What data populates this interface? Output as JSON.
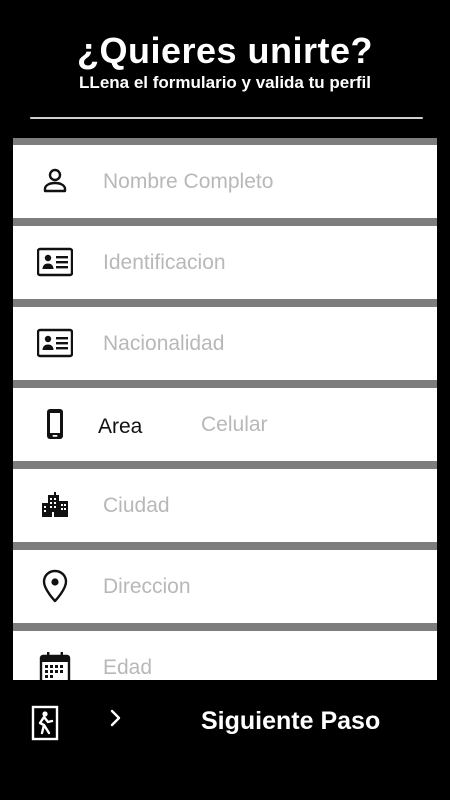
{
  "header": {
    "title": "¿Quieres unirte?",
    "subtitle": "LLena el formulario y valida tu perfil"
  },
  "form": {
    "fields": [
      {
        "icon": "person-icon",
        "placeholder": "Nombre Completo"
      },
      {
        "icon": "id-card-icon",
        "placeholder": "Identificacion"
      },
      {
        "icon": "id-card-icon",
        "placeholder": "Nacionalidad"
      },
      {
        "icon": "phone-icon",
        "area_label": "Area",
        "placeholder": "Celular"
      },
      {
        "icon": "city-icon",
        "placeholder": "Ciudad"
      },
      {
        "icon": "location-pin-icon",
        "placeholder": "Direccion"
      },
      {
        "icon": "calendar-icon",
        "placeholder": "Edad"
      }
    ]
  },
  "footer": {
    "exit_icon": "exit-door-icon",
    "chevron_icon": "chevron-right-icon",
    "next_label": "Siguiente Paso"
  },
  "colors": {
    "background": "#000000",
    "field_background": "#ffffff",
    "field_separator": "#7d7d7d",
    "placeholder": "#b8b8b8"
  }
}
